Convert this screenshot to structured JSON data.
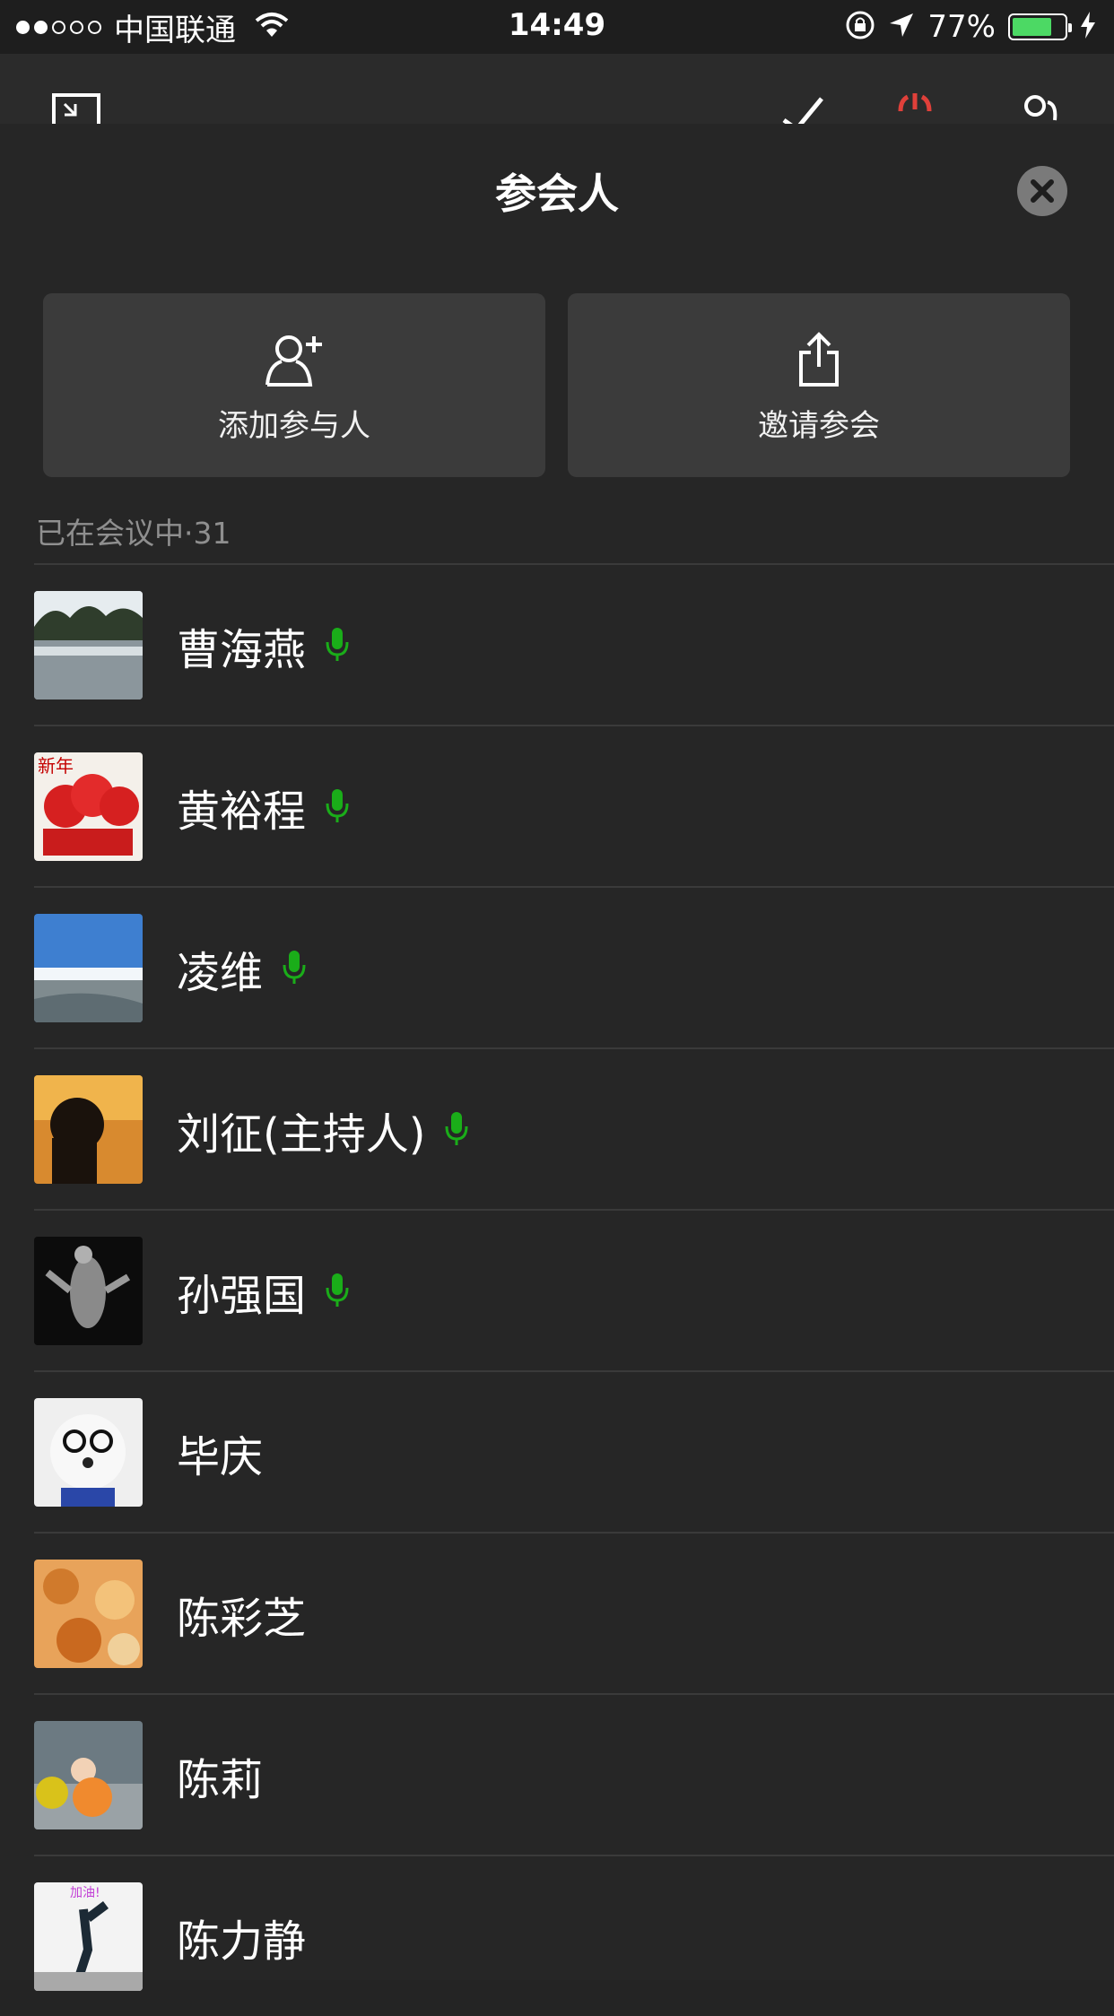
{
  "status_bar": {
    "carrier": "中国联通",
    "time": "14:49",
    "battery": "77%",
    "battery_level": 0.77,
    "signal_bars_filled": 2,
    "signal_bars_total": 5
  },
  "panel": {
    "title": "参会人",
    "actions": [
      {
        "label": "添加参与人",
        "icon": "add-person-icon"
      },
      {
        "label": "邀请参会",
        "icon": "share-icon"
      }
    ],
    "section_label": "已在会议中·31"
  },
  "participants": [
    {
      "name": "曹海燕",
      "speaking": true
    },
    {
      "name": "黄裕程",
      "speaking": true
    },
    {
      "name": "凌维",
      "speaking": true
    },
    {
      "name": "刘征(主持人)",
      "speaking": true
    },
    {
      "name": "孙强国",
      "speaking": true
    },
    {
      "name": "毕庆",
      "speaking": false
    },
    {
      "name": "陈彩芝",
      "speaking": false
    },
    {
      "name": "陈莉",
      "speaking": false
    },
    {
      "name": "陈力静",
      "speaking": false
    }
  ],
  "colors": {
    "background": "#242424",
    "mic_active": "#1aad19",
    "action_bg": "#3b3b3b",
    "end_call": "#e0403a"
  }
}
